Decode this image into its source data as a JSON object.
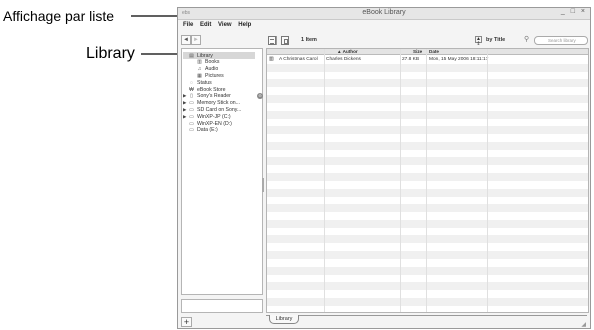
{
  "callouts": {
    "view_list": "Affichage par liste",
    "library": "Library"
  },
  "window": {
    "app_label": "ebs",
    "title": "eBook Library",
    "controls": "_ □ ×"
  },
  "menu": [
    "File",
    "Edit",
    "View",
    "Help"
  ],
  "nav": {
    "back": "◄",
    "forward": "►"
  },
  "sidebar": {
    "items": [
      {
        "label": "Library",
        "icon": "library-icon",
        "glyph": "▤",
        "selected": true,
        "expandable": false,
        "indent": 0
      },
      {
        "label": "Books",
        "icon": "book-icon",
        "glyph": "▥",
        "selected": false,
        "expandable": false,
        "indent": 1
      },
      {
        "label": "Audio",
        "icon": "music-note-icon",
        "glyph": "♫",
        "selected": false,
        "expandable": false,
        "indent": 1
      },
      {
        "label": "Pictures",
        "icon": "picture-icon",
        "glyph": "▦",
        "selected": false,
        "expandable": false,
        "indent": 1
      },
      {
        "label": "Status",
        "icon": "status-icon",
        "glyph": "◌",
        "selected": false,
        "expandable": false,
        "indent": 0
      },
      {
        "label": "eBook Store",
        "icon": "store-icon",
        "glyph": "₩",
        "selected": false,
        "expandable": false,
        "indent": 0
      },
      {
        "label": "Sony's Reader",
        "icon": "reader-device-icon",
        "glyph": "▯",
        "selected": false,
        "expandable": true,
        "indent": 0,
        "badge": "⊖"
      },
      {
        "label": "Memory Stick on...",
        "icon": "memory-stick-icon",
        "glyph": "▭",
        "selected": false,
        "expandable": true,
        "indent": 0
      },
      {
        "label": "SD Card on Sony...",
        "icon": "sd-card-icon",
        "glyph": "▭",
        "selected": false,
        "expandable": true,
        "indent": 0
      },
      {
        "label": "WinXP-JP (C:)",
        "icon": "drive-icon",
        "glyph": "▭",
        "selected": false,
        "expandable": true,
        "indent": 0
      },
      {
        "label": "WinXP-EN (D:)",
        "icon": "drive-icon",
        "glyph": "▭",
        "selected": false,
        "expandable": false,
        "indent": 0
      },
      {
        "label": "Data (E:)",
        "icon": "drive-icon",
        "glyph": "▭",
        "selected": false,
        "expandable": false,
        "indent": 0
      }
    ]
  },
  "toolbar": {
    "item_count": "1 Item",
    "sort_order": "▲ ⇕",
    "sort_by": "by Title",
    "search_placeholder": "Search library",
    "search_icon": "magnifier-icon"
  },
  "table": {
    "columns": [
      "▲ Author",
      "Size",
      "Date"
    ],
    "rows": [
      {
        "title": "A Christmas Carol",
        "author": "Charles Dickens",
        "size": "27.8 KB",
        "date": "Mon, 15 May 2006 18:11:17"
      }
    ],
    "empty_rows": 32
  },
  "footer": {
    "add": "+",
    "tab": "Library",
    "grip": "◢"
  }
}
